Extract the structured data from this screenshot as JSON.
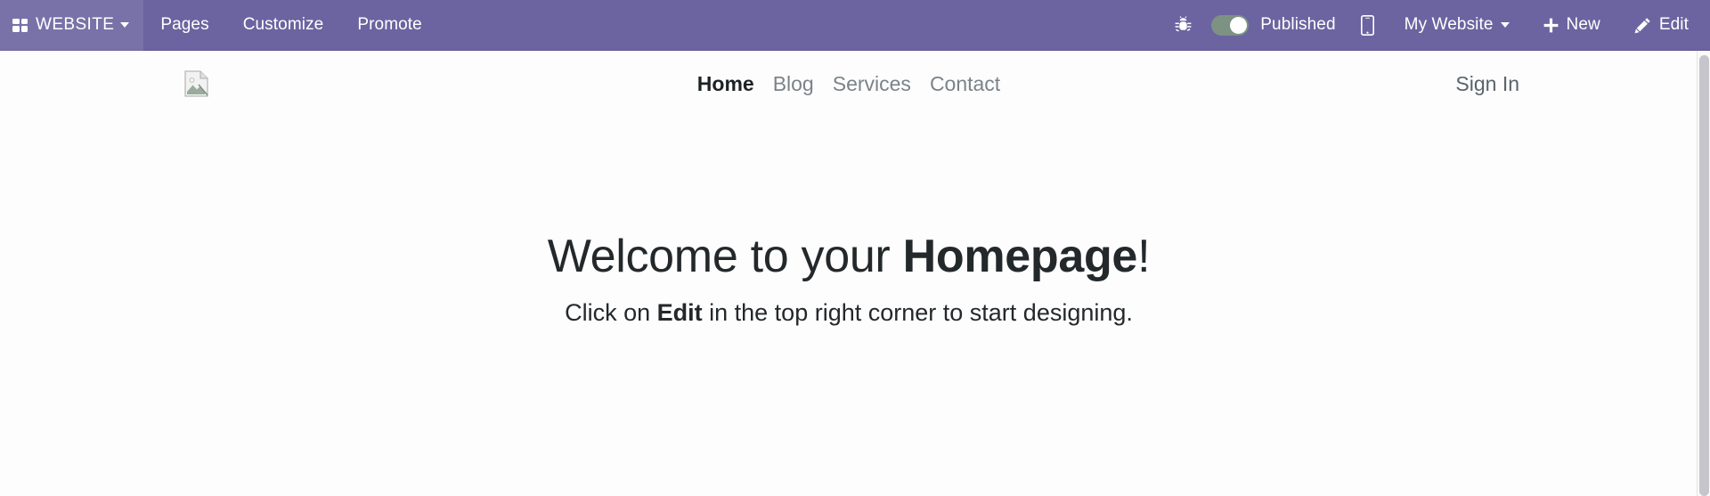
{
  "admin_bar": {
    "brand": {
      "icon": "grid-apps-icon",
      "label": "WEBSITE",
      "caret": "chevron-down-icon"
    },
    "menus": [
      {
        "label": "Pages"
      },
      {
        "label": "Customize"
      },
      {
        "label": "Promote"
      }
    ],
    "debug": {
      "icon": "bug-icon",
      "title": "Debug"
    },
    "publish_toggle": {
      "label": "Published",
      "state": "on",
      "track_color": "#7d9283",
      "knob_color": "#ffffff"
    },
    "mobile_preview": {
      "icon": "mobile-phone-icon",
      "title": "Mobile preview"
    },
    "account": {
      "label": "My Website",
      "caret": "chevron-down-icon"
    },
    "new": {
      "icon": "plus-icon",
      "label": "New"
    },
    "edit": {
      "icon": "pencil-icon",
      "label": "Edit"
    },
    "background_color": "#6c64a0",
    "text_color": "#ffffff"
  },
  "site": {
    "logo": {
      "icon": "broken-image-icon",
      "alt": ""
    },
    "nav": [
      {
        "label": "Home",
        "active": true
      },
      {
        "label": "Blog",
        "active": false
      },
      {
        "label": "Services",
        "active": false
      },
      {
        "label": "Contact",
        "active": false
      }
    ],
    "sign_in": {
      "label": "Sign In"
    },
    "hero": {
      "title_prefix": "Welcome to your ",
      "title_strong": "Homepage",
      "title_suffix": "!",
      "sub_prefix": "Click on ",
      "sub_strong": "Edit",
      "sub_suffix": " in the top right corner to start designing."
    }
  },
  "scrollbar": {
    "orientation": "vertical",
    "thumb_color": "#c5c5cb"
  }
}
